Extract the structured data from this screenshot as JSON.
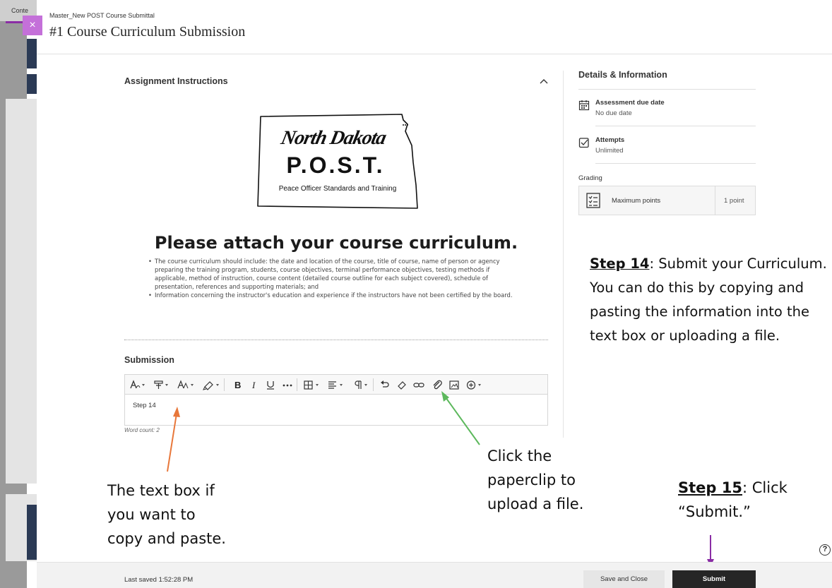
{
  "background": {
    "tab_label": "Conte",
    "accent_color": "#8a2da5"
  },
  "close_glyph": "×",
  "header": {
    "breadcrumb": "Master_New POST Course Submittal",
    "title": "#1 Course Curriculum Submission"
  },
  "instructions": {
    "section_title": "Assignment Instructions",
    "logo": {
      "script_text": "North Dakota",
      "acronym": "P.O.S.T.",
      "subtitle": "Peace Officer Standards and Training"
    },
    "heading": "Please attach your course curriculum.",
    "bullets": [
      "The course curriculum should include: the date and location of the course, title of course, name of person or agency preparing the training program, students, course objectives, terminal performance objectives, testing methods if applicable, method of instruction, course content (detailed course outline for each subject covered), schedule of presentation, references and supporting materials; and",
      "Information concerning the instructor's education and experience if the instructors have not been certified by the board."
    ]
  },
  "submission": {
    "section_title": "Submission",
    "editor_text": "Step 14",
    "word_count": "Word count: 2",
    "toolbar_icons": [
      "text-style-icon",
      "paragraph-style-icon",
      "font-size-icon",
      "highlight-icon",
      "bold-icon",
      "italic-icon",
      "underline-icon",
      "more-icon",
      "table-icon",
      "align-icon",
      "paragraph-mark-icon",
      "undo-icon",
      "clear-format-icon",
      "link-icon",
      "paperclip-icon",
      "image-icon",
      "add-content-icon"
    ]
  },
  "details": {
    "title": "Details & Information",
    "due_label": "Assessment due date",
    "due_value": "No due date",
    "attempts_label": "Attempts",
    "attempts_value": "Unlimited",
    "grading_label": "Grading",
    "max_points_label": "Maximum points",
    "max_points_value": "1 point"
  },
  "annotations": {
    "step14_label": "Step 14",
    "step14_lines": [
      ": Submit your Curriculum.",
      "You can do this by copying and",
      "pasting the information into the",
      "text box or uploading a file."
    ],
    "textbox_note": [
      "The text box if",
      "you want to",
      "copy and paste."
    ],
    "paperclip_note": [
      "Click the",
      "paperclip to",
      "upload a file."
    ],
    "step15_label": "Step 15",
    "step15_lines": [
      ": Click",
      "“Submit.”"
    ],
    "arrow_colors": {
      "orange": "#e8773a",
      "green": "#5cb85c",
      "purple": "#8a2da5"
    }
  },
  "footer": {
    "last_saved": "Last saved 1:52:28 PM",
    "save_close_label": "Save and Close",
    "submit_label": "Submit",
    "help_glyph": "?"
  }
}
